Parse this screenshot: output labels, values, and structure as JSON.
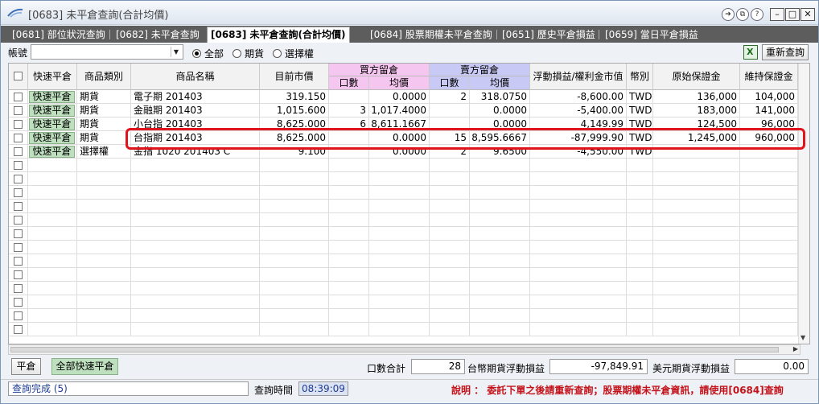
{
  "window": {
    "title": "[0683] 未平倉查詢(合計均價)"
  },
  "tabs": [
    {
      "label": "[0681] 部位狀況查詢",
      "active": false
    },
    {
      "label": "[0682] 未平倉查詢",
      "active": false
    },
    {
      "label": "[0683] 未平倉查詢(合計均價)",
      "active": true
    },
    {
      "label": "[0684] 股票期權未平倉查詢",
      "active": false
    },
    {
      "label": "[0651] 歷史平倉損益",
      "active": false
    },
    {
      "label": "[0659] 當日平倉損益",
      "active": false
    }
  ],
  "toolbar": {
    "account_label": "帳號",
    "account_value": "",
    "radio": [
      {
        "label": "全部",
        "checked": true
      },
      {
        "label": "期貨",
        "checked": false
      },
      {
        "label": "選擇權",
        "checked": false
      }
    ],
    "requery_label": "重新查詢"
  },
  "grid": {
    "headers": {
      "quick_close": "快速平倉",
      "category": "商品類別",
      "product": "商品名稱",
      "market_price": "目前市價",
      "buy_group": "買方留倉",
      "buy_qty": "口數",
      "buy_avg": "均價",
      "sell_group": "賣方留倉",
      "sell_qty": "口數",
      "sell_avg": "均價",
      "float_pl": "浮動損益/權利金市值",
      "currency": "幣別",
      "initial_margin": "原始保證金",
      "maint_margin": "維持保證金"
    },
    "quick_label": "快速平倉",
    "rows": [
      {
        "category": "期貨",
        "product": "電子期 201403",
        "price": "319.150",
        "buy_qty": "",
        "buy_avg": "0.0000",
        "sell_qty": "2",
        "sell_avg": "318.0750",
        "pl": "-8,600.00",
        "cur": "TWD",
        "im": "136,000",
        "mm": "104,000"
      },
      {
        "category": "期貨",
        "product": "金融期 201403",
        "price": "1,015.600",
        "buy_qty": "3",
        "buy_avg": "1,017.4000",
        "sell_qty": "",
        "sell_avg": "0.0000",
        "pl": "-5,400.00",
        "cur": "TWD",
        "im": "183,000",
        "mm": "141,000"
      },
      {
        "category": "期貨",
        "product": "小台指 201403",
        "price": "8,625.000",
        "buy_qty": "6",
        "buy_avg": "8,611.1667",
        "sell_qty": "",
        "sell_avg": "0.0000",
        "pl": "4,149.99",
        "cur": "TWD",
        "im": "124,500",
        "mm": "96,000"
      },
      {
        "category": "期貨",
        "product": "台指期 201403",
        "price": "8,625.000",
        "buy_qty": "",
        "buy_avg": "0.0000",
        "sell_qty": "15",
        "sell_avg": "8,595.6667",
        "pl": "-87,999.90",
        "cur": "TWD",
        "im": "1,245,000",
        "mm": "960,000"
      },
      {
        "category": "選擇權",
        "product": "金指 1020 201403 C",
        "price": "9.100",
        "buy_qty": "",
        "buy_avg": "0.0000",
        "sell_qty": "2",
        "sell_avg": "9.6500",
        "pl": "-4,550.00",
        "cur": "TWD",
        "im": "",
        "mm": ""
      }
    ],
    "empty_rows": 13
  },
  "bottom": {
    "close_label": "平倉",
    "close_all_label": "全部快速平倉",
    "qty_total_label": "口數合計",
    "qty_total": "28",
    "twd_pl_label": "台幣期貨浮動損益",
    "twd_pl": "-97,849.91",
    "usd_pl_label": "美元期貨浮動損益",
    "usd_pl": "0.00"
  },
  "status": {
    "message": "查詢完成 (5)",
    "time_label": "查詢時間",
    "time": "08:39:09",
    "note": "說明 ： 委託下單之後請重新查詢；股票期權未平倉資訊，請使用[0684]查詢"
  },
  "colors": {
    "buy_header": "#f5c6f0",
    "sell_header": "#c9c9f5",
    "quick_button": "#bfe0bf",
    "highlight": "#e0141c",
    "note_text": "#c4121a"
  }
}
